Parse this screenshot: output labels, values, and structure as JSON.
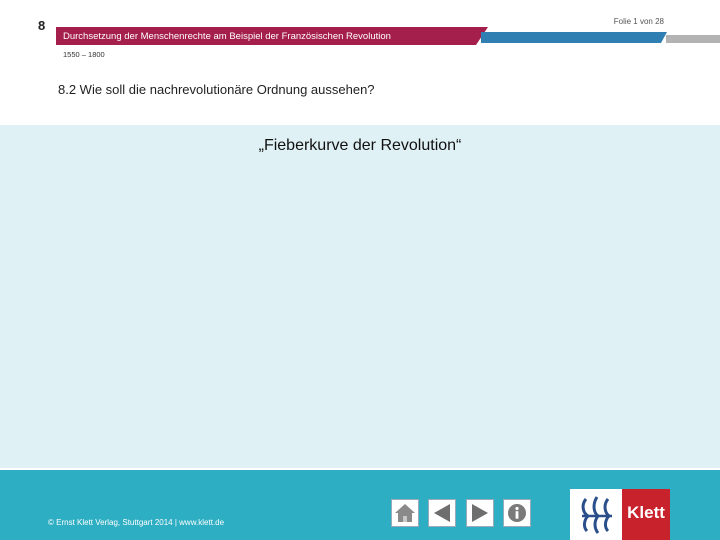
{
  "header": {
    "chapter_number": "8",
    "slide_counter": "Folie 1 von 28",
    "title": "Durchsetzung der Menschenrechte am Beispiel der Französischen Revolution",
    "period": "1550 – 1800",
    "subtitle": "8.2  Wie soll die nachrevolutionäre Ordnung aussehen?"
  },
  "main": {
    "heading": "„Fieberkurve der Revolution“"
  },
  "footer": {
    "copyright": "© Ernst Klett Verlag, Stuttgart 2014 | www.klett.de",
    "nav": {
      "home_icon": "home-icon",
      "prev_icon": "arrow-left-icon",
      "next_icon": "arrow-right-icon",
      "info_icon": "info-icon"
    },
    "logo_text": "Klett"
  },
  "colors": {
    "title_bar": "#a41f4c",
    "accent_blue": "#2f7fb2",
    "content_bg": "#dff1f4",
    "footer_bg": "#2daec2",
    "logo_red": "#c8222d"
  }
}
